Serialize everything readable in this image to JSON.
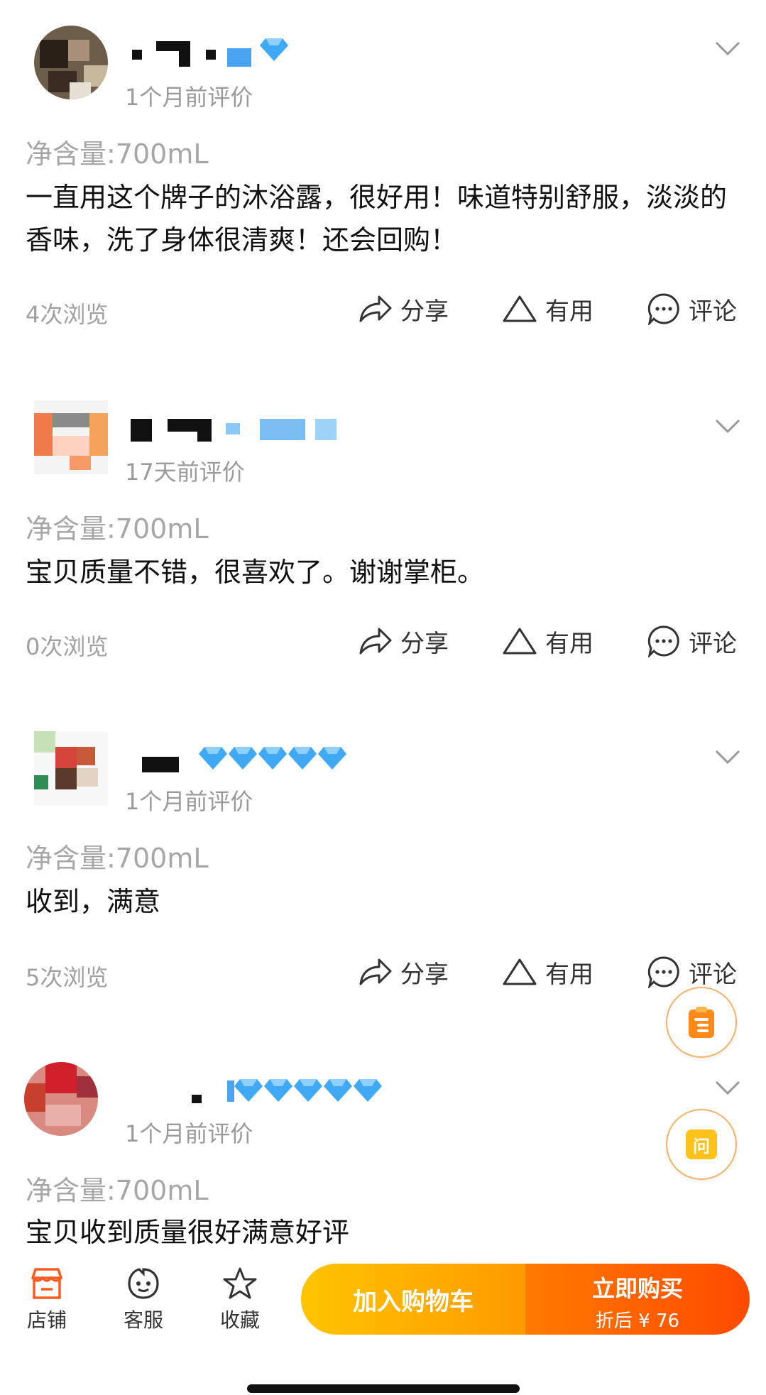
{
  "reviews": [
    {
      "time": "1个月前评价",
      "spec": "净含量:700mL",
      "text": "一直用这个牌子的沐浴露，很好用！味道特别舒服，淡淡的香味，洗了身体很清爽！还会回购！",
      "views": "4次浏览",
      "share": "分享",
      "useful": "有用",
      "comment": "评论"
    },
    {
      "time": "17天前评价",
      "spec": "净含量:700mL",
      "text": "宝贝质量不错，很喜欢了。谢谢掌柜。",
      "views": "0次浏览",
      "share": "分享",
      "useful": "有用",
      "comment": "评论"
    },
    {
      "time": "1个月前评价",
      "spec": "净含量:700mL",
      "text": "收到，满意",
      "views": "5次浏览",
      "share": "分享",
      "useful": "有用",
      "comment": "评论"
    },
    {
      "time": "1个月前评价",
      "spec": "净含量:700mL",
      "text": "宝贝收到质量很好满意好评",
      "views": "",
      "share": "",
      "useful": "",
      "comment": ""
    }
  ],
  "float": {
    "ask_label": "问"
  },
  "bottom_bar": {
    "store": "店铺",
    "service": "客服",
    "favorite": "收藏",
    "add_to_cart": "加入购物车",
    "buy_now": "立即购买",
    "discount_price": "折后 ¥ 76"
  },
  "colors": {
    "accent_orange": "#ff6a00",
    "accent_yellow": "#ffc400",
    "diamond_blue": "#3fa9f5",
    "muted_text": "#a0a0a0"
  }
}
